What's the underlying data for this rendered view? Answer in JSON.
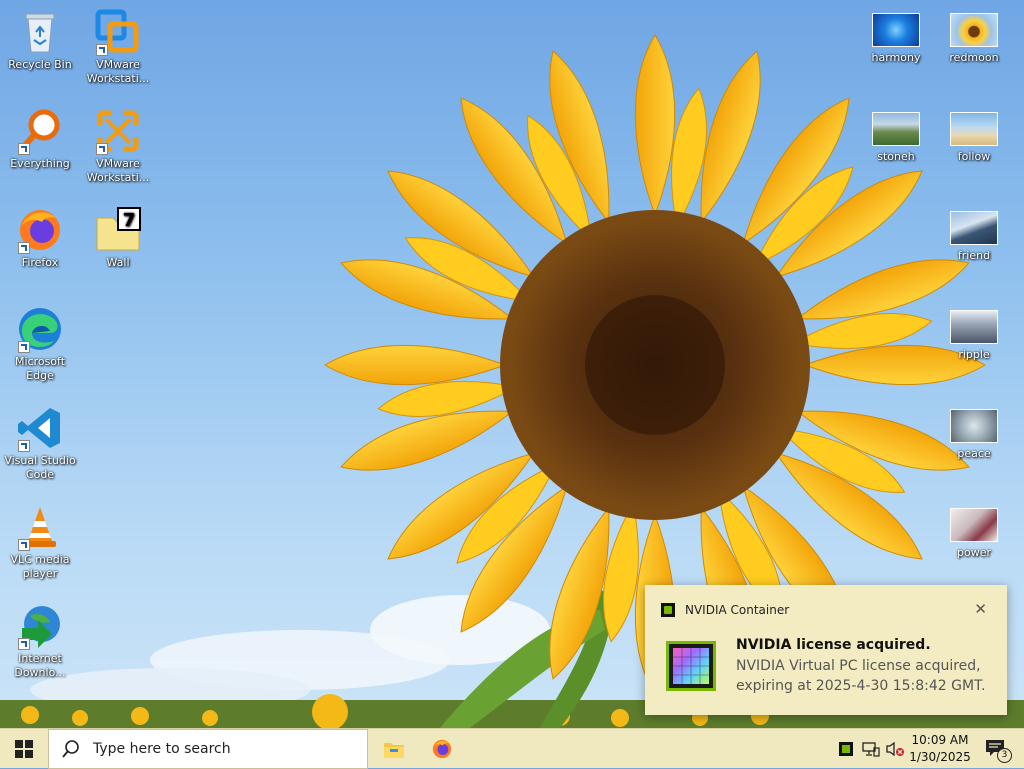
{
  "desktop_icons_left": [
    {
      "id": "recycle-bin",
      "label": "Recycle Bin"
    },
    {
      "id": "vmware-workstation-1",
      "label": "VMware Workstati..."
    },
    {
      "id": "everything",
      "label": "Everything"
    },
    {
      "id": "vmware-workstation-2",
      "label": "VMware Workstati..."
    },
    {
      "id": "firefox",
      "label": "Firefox"
    },
    {
      "id": "wall",
      "label": "Wall"
    },
    {
      "id": "microsoft-edge",
      "label": "Microsoft Edge"
    },
    {
      "id": "visual-studio-code",
      "label": "Visual Studio Code"
    },
    {
      "id": "vlc-media-player",
      "label": "VLC media player"
    },
    {
      "id": "internet-download",
      "label": "Internet Downlo..."
    }
  ],
  "desktop_icons_right": [
    {
      "id": "harmony",
      "label": "harmony"
    },
    {
      "id": "redmoon",
      "label": "redmoon"
    },
    {
      "id": "stoneh",
      "label": "stoneh"
    },
    {
      "id": "follow",
      "label": "follow"
    },
    {
      "id": "friend",
      "label": "friend"
    },
    {
      "id": "ripple",
      "label": "ripple"
    },
    {
      "id": "peace",
      "label": "peace"
    },
    {
      "id": "power",
      "label": "power"
    }
  ],
  "notification": {
    "app_name": "NVIDIA Container",
    "close_glyph": "✕",
    "title": "NVIDIA license acquired.",
    "body": "NVIDIA Virtual PC license acquired, expiring at 2025-4-30 15:8:42 GMT."
  },
  "taskbar": {
    "search_placeholder": "Type here to search",
    "time": "10:09 AM",
    "date": "1/30/2025",
    "notification_count": "3"
  },
  "colors": {
    "taskbar_bg": "#f0e8bf",
    "toast_bg": "#f3ecc2",
    "nvidia_green": "#76b900"
  }
}
